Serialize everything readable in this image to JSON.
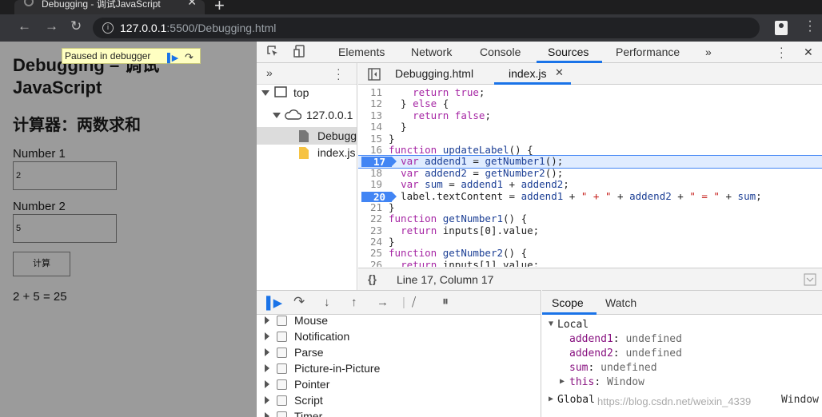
{
  "browser": {
    "tab_title": "Debugging - 调试JavaScript",
    "close_glyph": "✕",
    "newtab_glyph": "+",
    "url_host": "127.0.0.1",
    "url_path": ":5500/Debugging.html"
  },
  "page": {
    "heading": "Debugging – 调试 JavaScript",
    "subheading": "计算器：两数求和",
    "number1_label": "Number 1",
    "number1_value": "2",
    "number2_label": "Number 2",
    "number2_value": "5",
    "calc_button": "计算",
    "result": "2 + 5 = 25"
  },
  "paused_overlay": {
    "text": "Paused in debugger"
  },
  "devtools": {
    "tabs": [
      "Elements",
      "Network",
      "Console",
      "Sources",
      "Performance"
    ],
    "active_tab": "Sources",
    "more_tabs": "»",
    "navigator": {
      "more": "»",
      "top": "top",
      "host": "127.0.0.1",
      "files": [
        "Debugging.html",
        "index.js"
      ]
    },
    "editor_tabs": [
      "Debugging.html",
      "index.js"
    ],
    "active_file": "index.js",
    "status": "Line 17, Column 17",
    "code": [
      {
        "n": "11",
        "text": "    return true;"
      },
      {
        "n": "12",
        "text": "  } else {"
      },
      {
        "n": "13",
        "text": "    return false;"
      },
      {
        "n": "14",
        "text": "  }"
      },
      {
        "n": "15",
        "text": "}"
      },
      {
        "n": "16",
        "text": "function updateLabel() {"
      },
      {
        "n": "17",
        "text": "  var addend1 = getNumber1();"
      },
      {
        "n": "18",
        "text": "  var addend2 = getNumber2();"
      },
      {
        "n": "19",
        "text": "  var sum = addend1 + addend2;"
      },
      {
        "n": "20",
        "text": "  label.textContent = addend1 + \" + \" + addend2 + \" = \" + sum;"
      },
      {
        "n": "21",
        "text": "}"
      },
      {
        "n": "22",
        "text": "function getNumber1() {"
      },
      {
        "n": "23",
        "text": "  return inputs[0].value;"
      },
      {
        "n": "24",
        "text": "}"
      },
      {
        "n": "25",
        "text": "function getNumber2() {"
      },
      {
        "n": "26",
        "text": "  return inputs[1].value;"
      }
    ],
    "breakpoint_lines": [
      "17",
      "20"
    ],
    "event_breakpoints": [
      "Mouse",
      "Notification",
      "Parse",
      "Picture-in-Picture",
      "Pointer",
      "Script",
      "Timer"
    ],
    "scope_tabs": [
      "Scope",
      "Watch"
    ],
    "scope": {
      "local_label": "Local",
      "vars": [
        {
          "name": "addend1",
          "value": "undefined"
        },
        {
          "name": "addend2",
          "value": "undefined"
        },
        {
          "name": "sum",
          "value": "undefined"
        },
        {
          "name": "this",
          "value": "Window"
        }
      ],
      "global_label": "Global",
      "global_value": "Window"
    }
  },
  "watermark": "https://blog.csdn.net/weixin_4339"
}
